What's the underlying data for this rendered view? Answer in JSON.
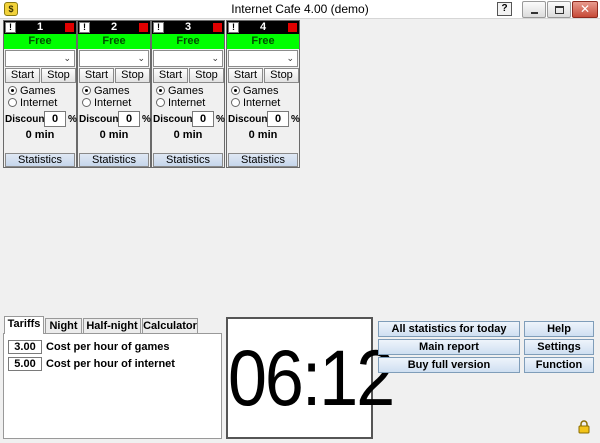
{
  "window": {
    "title": "Internet Cafe 4.00 (demo)",
    "help_glyph": "?",
    "app_icon": "$"
  },
  "stations": [
    {
      "number": "1",
      "status": "Free",
      "start": "Start",
      "stop": "Stop",
      "games": "Games",
      "internet": "Internet",
      "discount_label": "Discount",
      "discount_value": "0",
      "percent": "%",
      "time": "0 min",
      "statistics": "Statistics",
      "mode": "games"
    },
    {
      "number": "2",
      "status": "Free",
      "start": "Start",
      "stop": "Stop",
      "games": "Games",
      "internet": "Internet",
      "discount_label": "Discount",
      "discount_value": "0",
      "percent": "%",
      "time": "0 min",
      "statistics": "Statistics",
      "mode": "games"
    },
    {
      "number": "3",
      "status": "Free",
      "start": "Start",
      "stop": "Stop",
      "games": "Games",
      "internet": "Internet",
      "discount_label": "Discount",
      "discount_value": "0",
      "percent": "%",
      "time": "0 min",
      "statistics": "Statistics",
      "mode": "games"
    },
    {
      "number": "4",
      "status": "Free",
      "start": "Start",
      "stop": "Stop",
      "games": "Games",
      "internet": "Internet",
      "discount_label": "Discount",
      "discount_value": "0",
      "percent": "%",
      "time": "0 min",
      "statistics": "Statistics",
      "mode": "games"
    }
  ],
  "station_bang": "!",
  "tabs": [
    {
      "label": "Tariffs",
      "active": true
    },
    {
      "label": "Night",
      "active": false
    },
    {
      "label": "Half-night",
      "active": false
    },
    {
      "label": "Calculator",
      "active": false
    }
  ],
  "tariffs": [
    {
      "value": "3.00",
      "label": "Cost per hour of games"
    },
    {
      "value": "5.00",
      "label": "Cost per hour of internet"
    }
  ],
  "clock": "06:12",
  "actions": {
    "all_stats": "All statistics for today",
    "main_report": "Main report",
    "buy_full": "Buy full version",
    "help": "Help",
    "settings": "Settings",
    "function": "Function"
  },
  "colors": {
    "status_free": "#00ff00",
    "station_header": "#000000",
    "indicator_red": "#e00000"
  }
}
